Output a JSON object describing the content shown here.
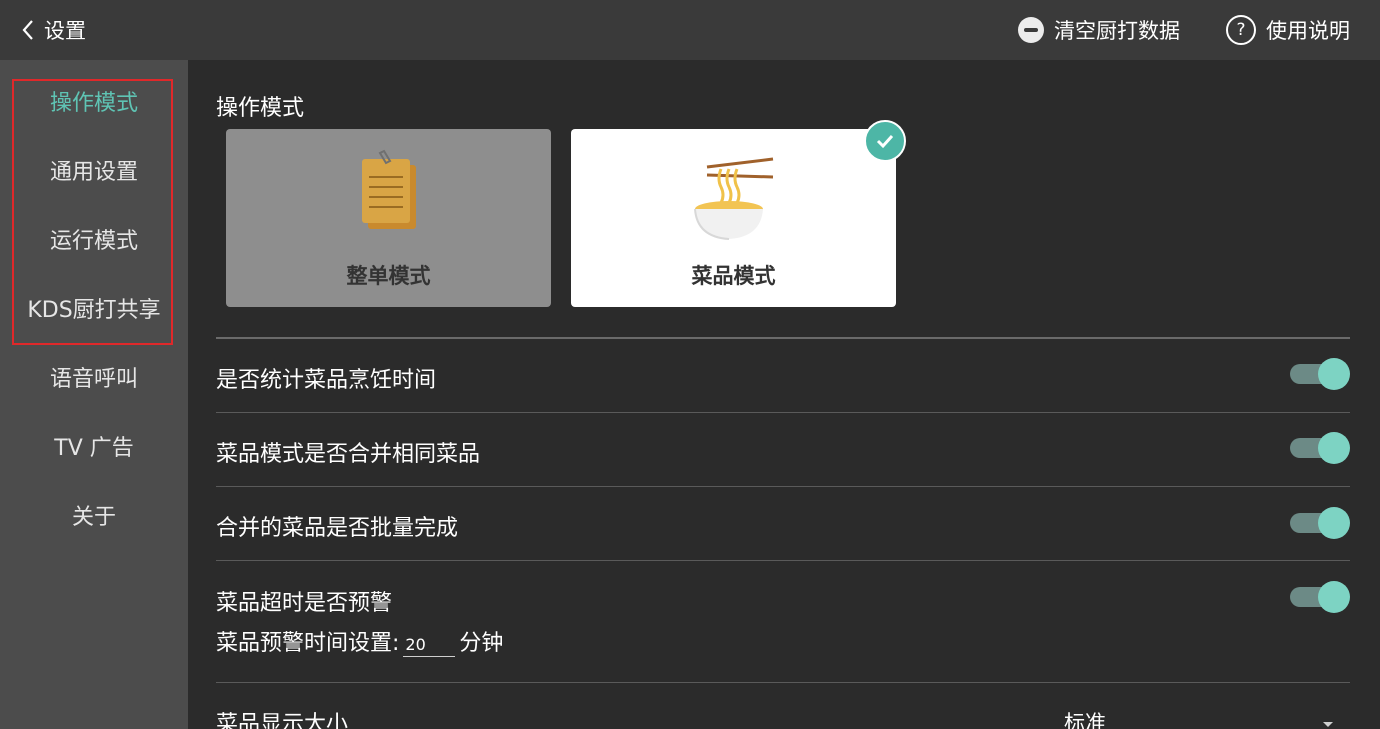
{
  "header": {
    "back_label": "设置",
    "clear_label": "清空厨打数据",
    "help_label": "使用说明",
    "help_symbol": "?"
  },
  "sidebar": {
    "items": [
      {
        "label": "操作模式",
        "active": true
      },
      {
        "label": "通用设置",
        "active": false
      },
      {
        "label": "运行模式",
        "active": false
      },
      {
        "label": "KDS厨打共享",
        "active": false
      },
      {
        "label": "语音呼叫",
        "active": false
      },
      {
        "label": "TV 广告",
        "active": false
      },
      {
        "label": "关于",
        "active": false
      }
    ]
  },
  "main": {
    "section_title": "操作模式",
    "modes": [
      {
        "label": "整单模式",
        "selected": false,
        "icon": "notepad-icon"
      },
      {
        "label": "菜品模式",
        "selected": true,
        "icon": "noodle-bowl-icon"
      }
    ],
    "settings": [
      {
        "label": "是否统计菜品烹饪时间",
        "enabled": true
      },
      {
        "label": "菜品模式是否合并相同菜品",
        "enabled": true
      },
      {
        "label": "合并的菜品是否批量完成",
        "enabled": true
      },
      {
        "label": "菜品超时是否预警",
        "enabled": true
      }
    ],
    "warn_time": {
      "label": "菜品预警时间设置:",
      "value": "20",
      "unit": "分钟"
    },
    "display_size": {
      "label": "菜品显示大小",
      "value": "标准"
    }
  },
  "colors": {
    "accent": "#5fc4b4",
    "toggle_thumb": "#7dd3c3",
    "highlight_border": "#e0282a"
  }
}
